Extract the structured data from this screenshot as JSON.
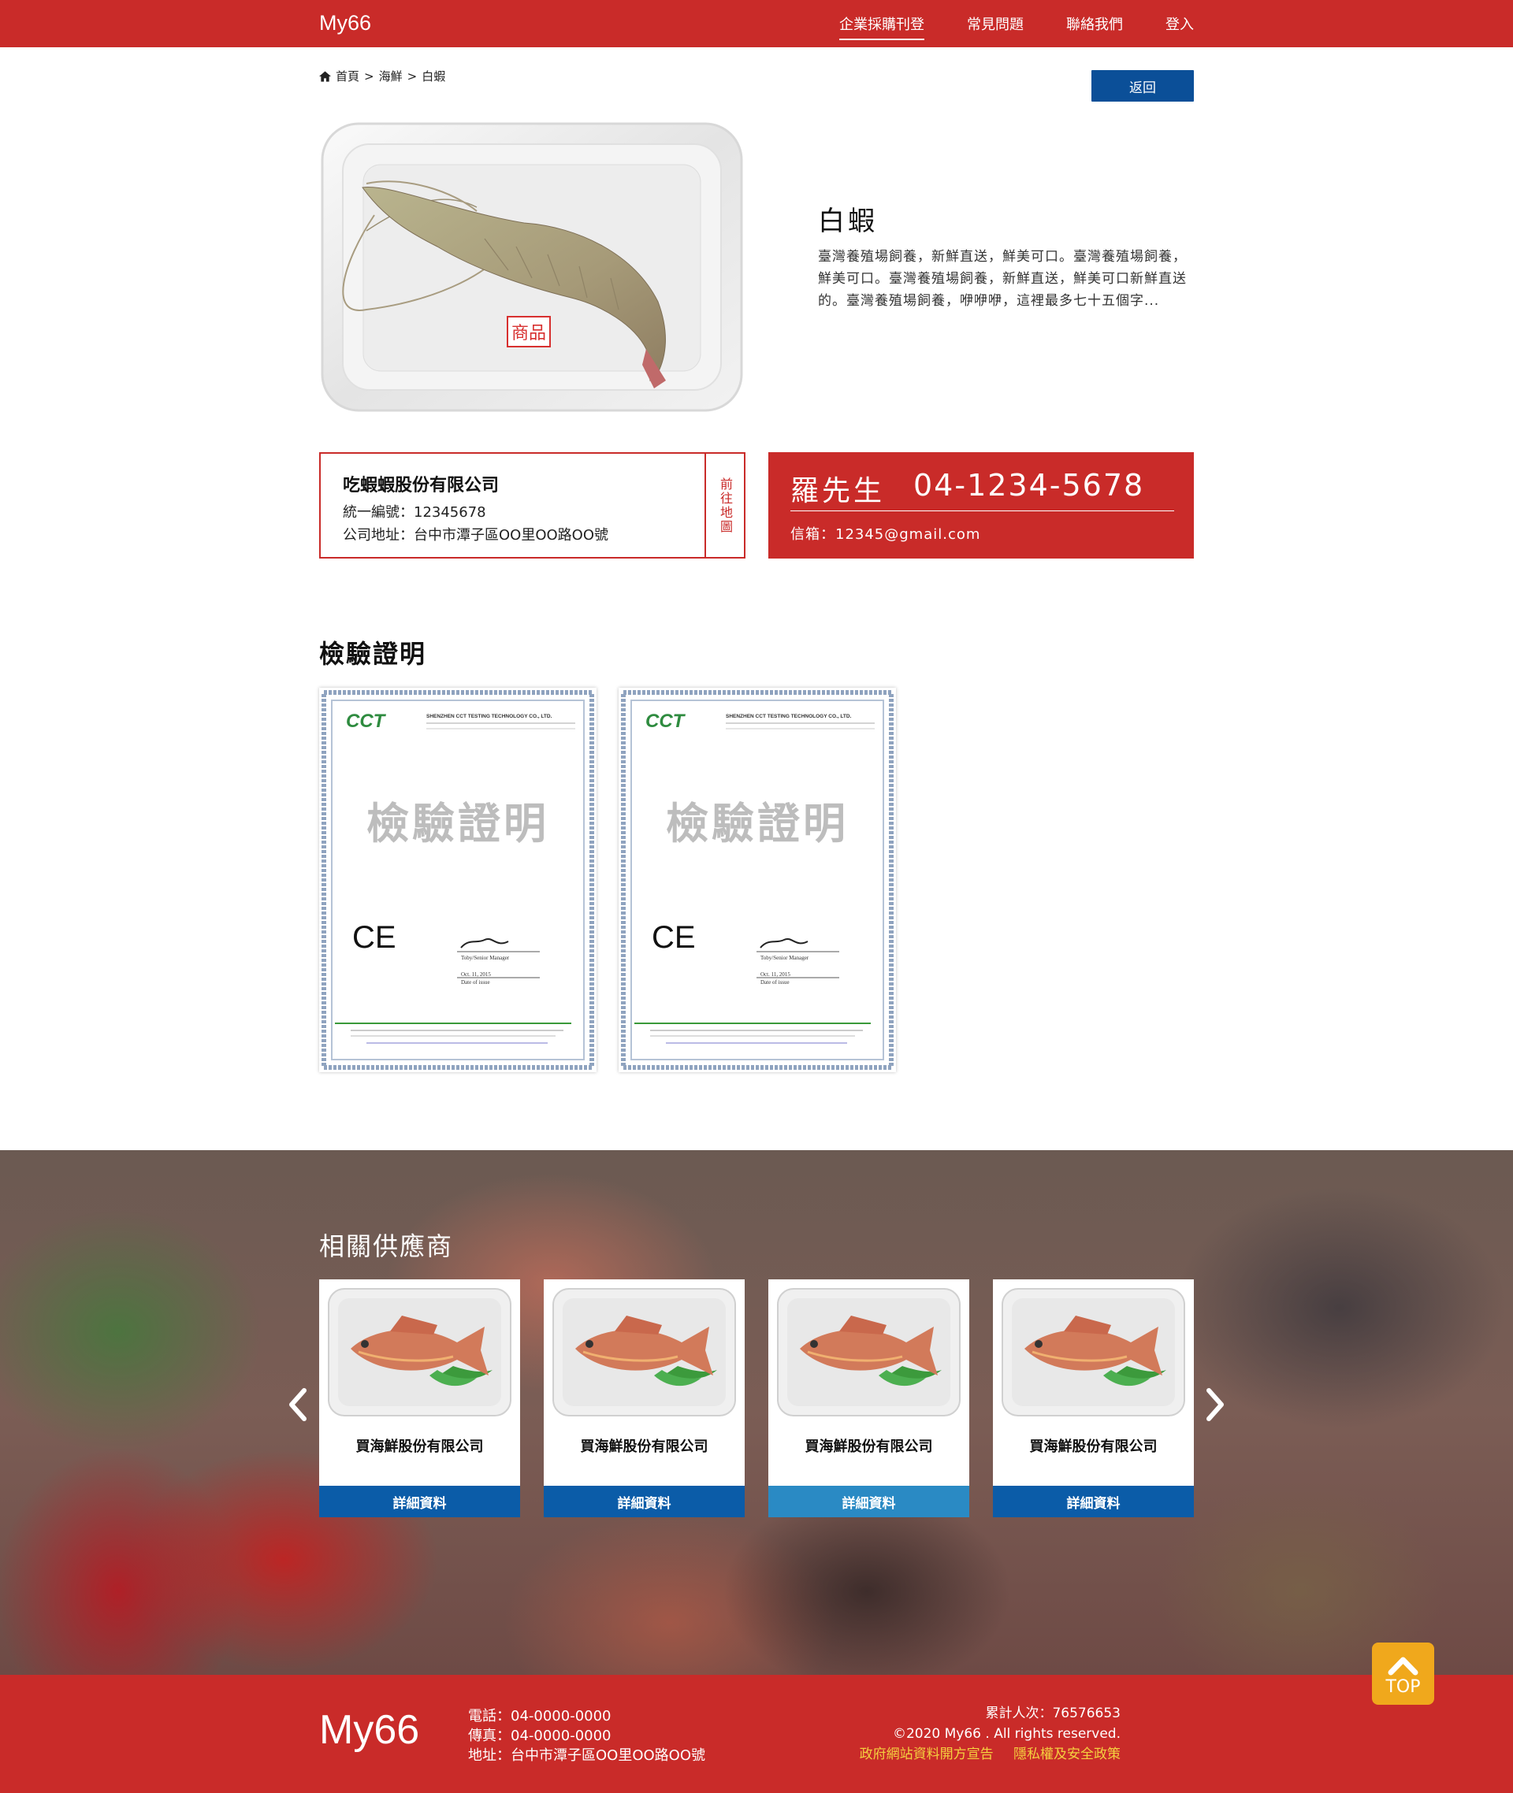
{
  "header": {
    "brand": "My66",
    "nav": [
      "企業採購刊登",
      "常見問題",
      "聯絡我們",
      "登入"
    ]
  },
  "breadcrumb": [
    "首頁",
    "海鮮",
    "白蝦"
  ],
  "back_label": "返回",
  "product": {
    "tag": "商品",
    "title": "白蝦",
    "description": "臺灣養殖場飼養，新鮮直送，鮮美可口。臺灣養殖場飼養，鮮美可口。臺灣養殖場飼養，新鮮直送，鮮美可口新鮮直送的。臺灣養殖場飼養，咿咿咿，這裡最多七十五個字..."
  },
  "company": {
    "name": "吃蝦蝦股份有限公司",
    "tax_id": "統一編號：12345678",
    "address": "公司地址：台中市潭子區OO里OO路OO號",
    "map_label": "前往地圖"
  },
  "contact": {
    "person": "羅先生",
    "phone": "04-1234-5678",
    "email": "信箱：12345@gmail.com"
  },
  "certificates": {
    "title": "檢驗證明",
    "items": [
      {
        "watermark": "檢驗證明",
        "issuer": "SHENZHEN CCT TESTING TECHNOLOGY CO., LTD.",
        "logo": "CCT",
        "mark": "CE",
        "date": "Oct. 11, 2015",
        "date_label": "Date of issue",
        "signer": "Toby/Senior Manager"
      },
      {
        "watermark": "檢驗證明",
        "issuer": "SHENZHEN CCT TESTING TECHNOLOGY CO., LTD.",
        "logo": "CCT",
        "mark": "CE",
        "date": "Oct. 11, 2015",
        "date_label": "Date of issue",
        "signer": "Toby/Senior Manager"
      }
    ]
  },
  "related": {
    "title": "相關供應商",
    "cards": [
      {
        "name": "買海鮮股份有限公司",
        "button": "詳細資料"
      },
      {
        "name": "買海鮮股份有限公司",
        "button": "詳細資料"
      },
      {
        "name": "買海鮮股份有限公司",
        "button": "詳細資料"
      },
      {
        "name": "買海鮮股份有限公司",
        "button": "詳細資料"
      }
    ]
  },
  "footer": {
    "brand": "My66",
    "phone": "電話：04-0000-0000",
    "fax": "傳真：04-0000-0000",
    "address": "地址：台中市潭子區OO里OO路OO號",
    "visitors": "累計人次：76576653",
    "copyright": "©2020 My66 . All rights reserved.",
    "links": [
      "政府網站資料開方宣告",
      "隱私權及安全政策"
    ]
  },
  "top_button": "TOP",
  "colors": {
    "brand_red": "#c92b29",
    "button_blue": "#0b4f98",
    "top_orange": "#f0a81c",
    "footer_link": "#f4d03f"
  }
}
